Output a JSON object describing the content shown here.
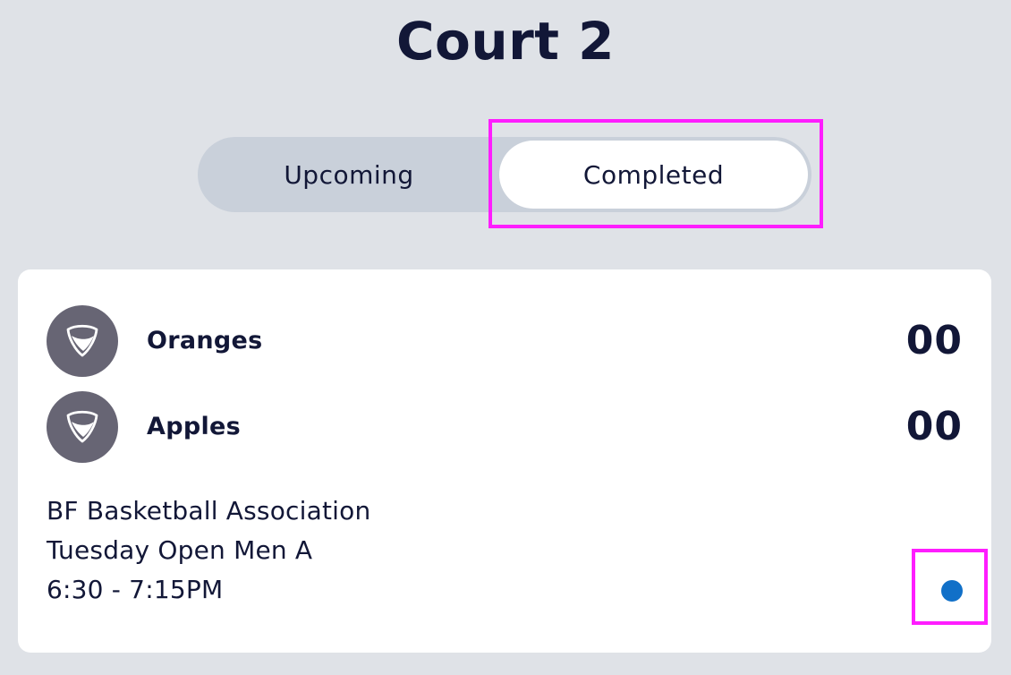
{
  "header": {
    "title": "Court 2"
  },
  "tabs": {
    "upcoming_label": "Upcoming",
    "completed_label": "Completed",
    "selected": "Completed"
  },
  "game": {
    "teams": [
      {
        "name": "Oranges",
        "score": "00",
        "icon": "shield-icon"
      },
      {
        "name": "Apples",
        "score": "00",
        "icon": "shield-icon"
      }
    ],
    "association": "BF Basketball Association",
    "league": "Tuesday Open Men A",
    "time": "6:30 - 7:15PM",
    "status_icon": "status-dot-icon"
  },
  "colors": {
    "background": "#dfe2e7",
    "toggle_track": "#c9d0da",
    "text": "#121737",
    "avatar": "#676574",
    "status_dot": "#1170c8",
    "highlight": "#ff1dff"
  }
}
